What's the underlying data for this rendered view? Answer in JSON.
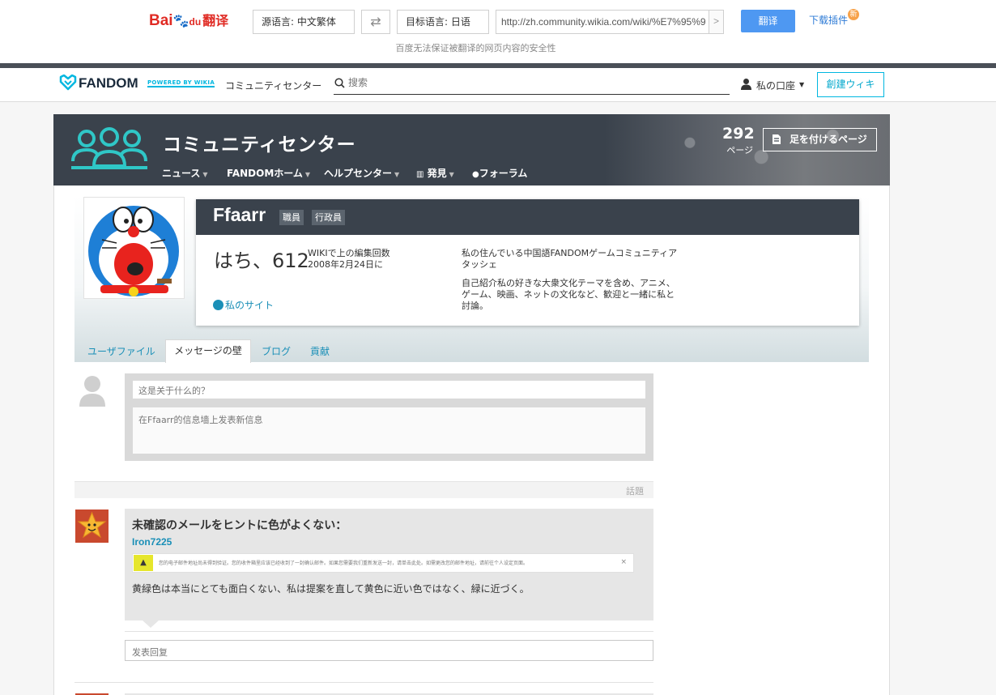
{
  "baidu": {
    "logo_bai": "Bai",
    "logo_du": "du",
    "logo_fanyi": "翻译",
    "source_lang": "源语言:  中文繁体",
    "swap_icon": "swap-icon",
    "target_lang": "目标语言:  日语",
    "url": "http://zh.community.wikia.com/wiki/%E7%95%9",
    "translate_button": "翻译",
    "plugin_link": "下载插件",
    "new_badge": "新",
    "security_note": "百度无法保证被翻译的网页内容的安全性"
  },
  "global_nav": {
    "brand": "FANDOM",
    "powered_by": "POWERED BY WIKIA",
    "community_link": "コミュニティセンター",
    "search_placeholder": "搜索",
    "account_label": "私の口座",
    "create_wiki_button": "創建ウィキ"
  },
  "wiki_header": {
    "title": "コミュニティセンター",
    "nav": [
      "ニュース",
      "FANDOMホーム",
      "ヘルプセンター",
      "発見",
      "フォーラム"
    ],
    "page_count": "292",
    "pages_label": "ページ",
    "add_page_button": "足を付けるページ"
  },
  "profile": {
    "username": "Ffaarr",
    "tags": [
      "職員",
      "行政員"
    ],
    "edit_count": "はち、612",
    "edit_label_line1": "WIKIで上の編集回数",
    "edit_label_line2": "2008年2月24日に",
    "my_site": "私のサイト",
    "bio_line1": "私の住んでいる中国語FANDOMゲームコミュニティアタッシェ",
    "bio_line2": "自己紹介私の好きな大衆文化テーマを含め、アニメ、ゲーム、映画、ネットの文化など、歓迎と一緒に私と討論。"
  },
  "tabs": [
    "ユーザファイル",
    "メッセージの壁",
    "ブログ",
    "貢献"
  ],
  "wall": {
    "title_placeholder": "这是关于什么的？",
    "body_placeholder": "在Ffaarr的信息墙上发表新信息",
    "topic_label": "話題",
    "thread": {
      "title": "未確認のメールをヒントに色がよくない：",
      "author": "Iron7225",
      "notice_text": "您的电子邮件地址尚未得到验证。您的收件箱里应该已经收到了一封确认邮件。如果您需要我们重新发送一封，请单击此处。如需更改您的邮件地址，请前往个人设定页面。",
      "notice_close": "×",
      "body": "黄緑色は本当にとても面白くない、私は提案を直して黄色に近い色ではなく、緑に近づく。"
    },
    "reply_placeholder": "发表回复"
  },
  "colors": {
    "fandom_cyan": "#00b7e0",
    "link_blue": "#1a8fb7",
    "header_dark": "#3a424c",
    "baidu_blue": "#4e98f2"
  }
}
